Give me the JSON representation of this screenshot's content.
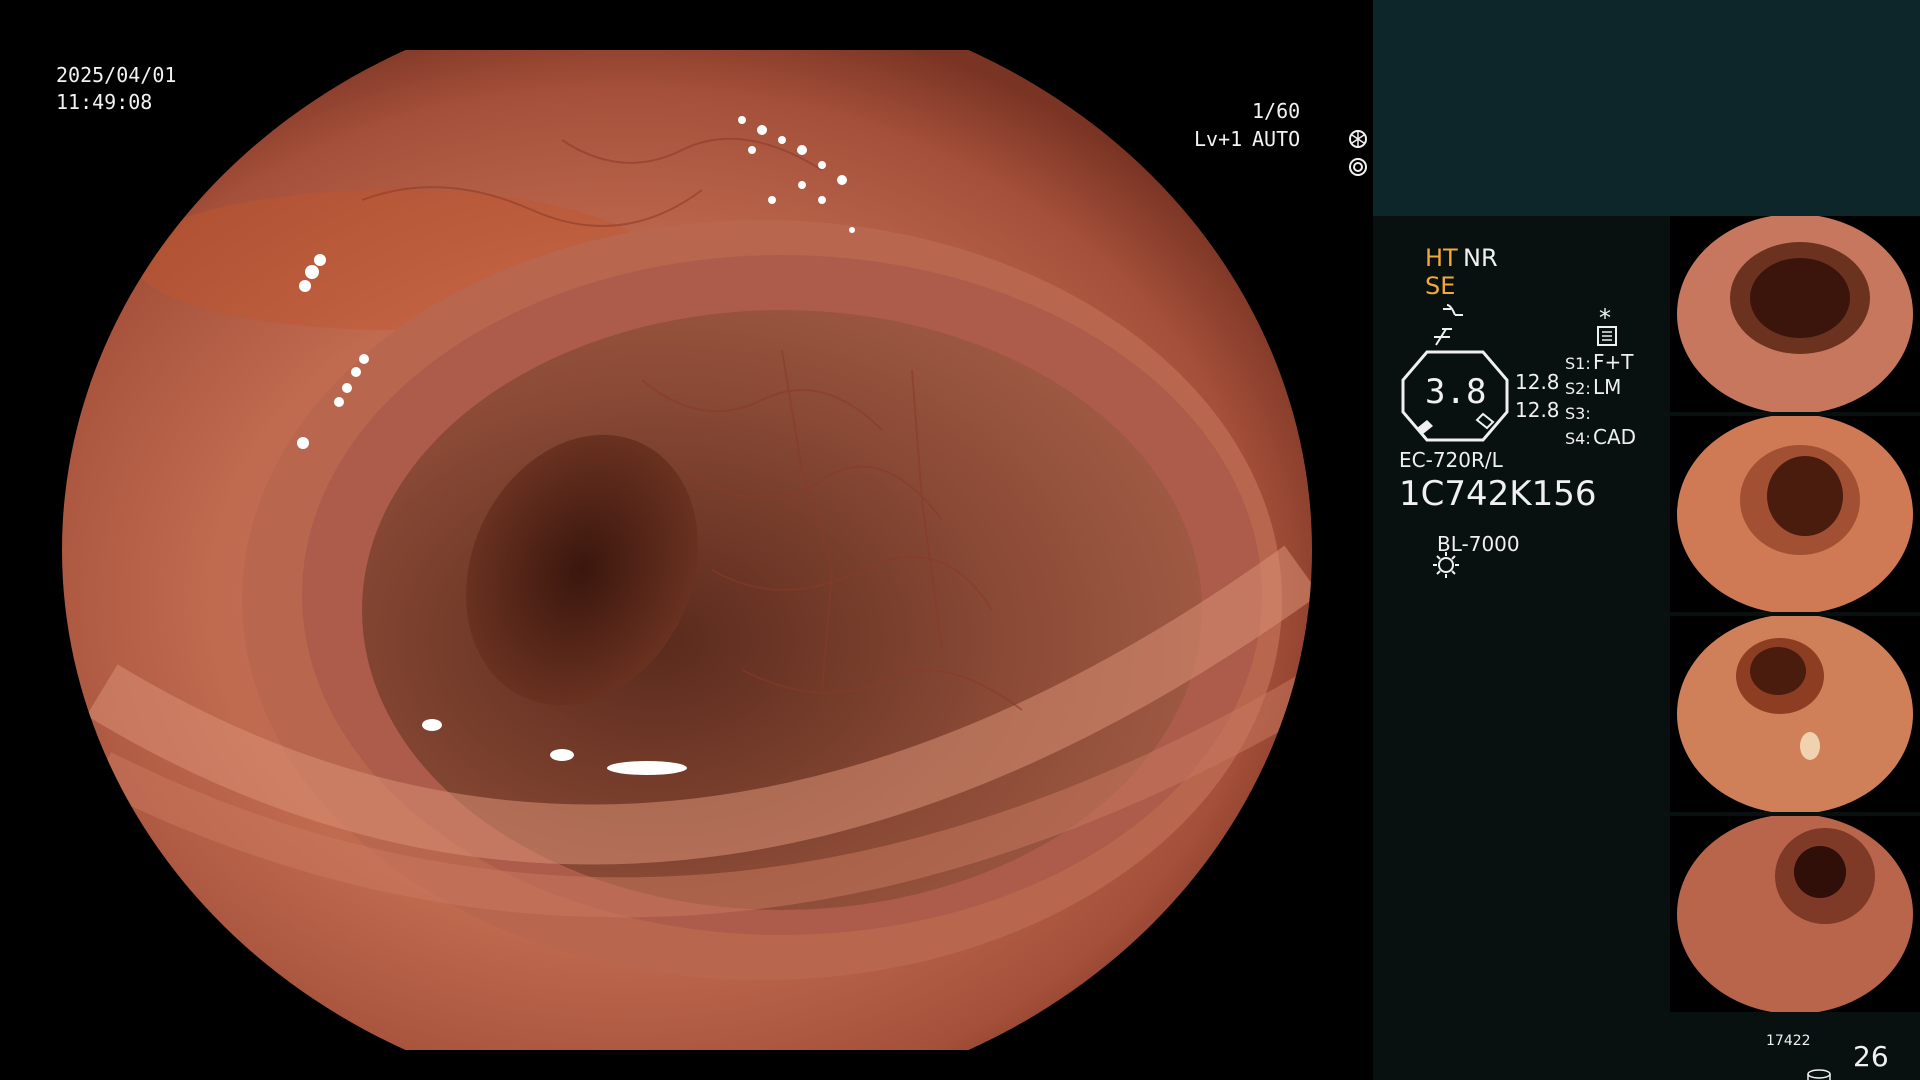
{
  "overlay": {
    "date": "2025/04/01",
    "time": "11:49:08",
    "shutter": "1/60",
    "shutter_icon": "shutter-icon",
    "level": "Lv+1",
    "auto_label": "AUTO",
    "auto_icon": "iris-icon"
  },
  "panel": {
    "ht": "HT",
    "nr": "NR",
    "se": "SE",
    "se_icon": "structure-enhance-icon",
    "freeze_icon": "freeze-icon",
    "settings_icon": "settings-list-icon",
    "asterisk": "*",
    "zoom_value": "3.8",
    "zoom_line1": "12.8",
    "zoom_line2": "12.8",
    "switches": [
      {
        "label": "S1:",
        "value": "F+T"
      },
      {
        "label": "S2:",
        "value": "LM"
      },
      {
        "label": "S3:",
        "value": ""
      },
      {
        "label": "S4:",
        "value": "CAD"
      }
    ],
    "scope_model": "EC-720R/L",
    "scope_serial": "1C742K156",
    "light_icon": "light-source-icon",
    "light_source": "BL-7000",
    "storage_icon": "storage-icon",
    "storage_count": "17422",
    "image_count": "26"
  },
  "colors": {
    "accent_orange": "#f2a93b",
    "panel_top": "#0d2629",
    "panel_body": "#081010"
  }
}
